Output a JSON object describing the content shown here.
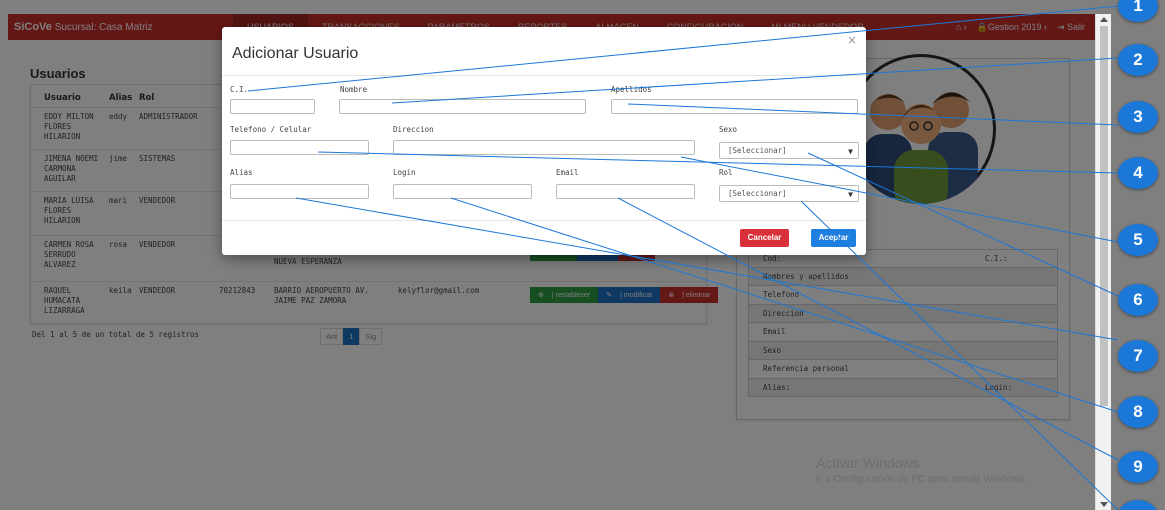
{
  "navbar": {
    "brand_name": "SiCoVe",
    "brand_sub": "Sucursal: Casa Matriz",
    "menu": [
      "USUARIOS",
      "TRANSACCIONES",
      "PARAMETROS",
      "REPORTES",
      "ALMACEN",
      "CONFIGURACION",
      "MI MENU VENDEDOR"
    ],
    "gestion": "Gestion 2019",
    "salir": "Salir"
  },
  "page": {
    "title": "Usuarios",
    "table_headers": {
      "usuario": "Usuario",
      "alias": "Alias",
      "rol": "Rol"
    },
    "rows": [
      {
        "usuario": "EDDY MILTON\nFLORES\nHILARION",
        "alias": "eddy",
        "rol": "ADMINISTRADOR",
        "telefono": "",
        "direccion": "",
        "email": ""
      },
      {
        "usuario": "JIMENA NOEMI\nCARMONA\nAGUILAR",
        "alias": "jime",
        "rol": "SISTEMAS",
        "telefono": "",
        "direccion": "",
        "email": ""
      },
      {
        "usuario": "MARIA LUISA\nFLORES\nHILARION",
        "alias": "mari",
        "rol": "VENDEDOR",
        "telefono": "",
        "direccion": "",
        "email": ""
      },
      {
        "usuario": "CARMEN ROSA\nSERRUDO\nALVAREZ",
        "alias": "rosa",
        "rol": "VENDEDOR",
        "telefono": "",
        "direccion": "NUEVA ESPERANZA",
        "email": ""
      },
      {
        "usuario": "RAQUEL\nHUMACATA\nLIZARRAGA",
        "alias": "keila",
        "rol": "VENDEDOR",
        "telefono": "70212843",
        "direccion": "BARRIO AEROPUERTO AV.\nJAIME PAZ ZAMORA",
        "email": "kelyflor@gmail.com"
      }
    ],
    "actions": {
      "restablecer": "| restablecer",
      "modificar": "| modificar",
      "eliminar": "| eliminar"
    },
    "footer": "Del 1 al 5 de un total de 5 registros",
    "pager": {
      "prev": "Ant",
      "current": "1",
      "next": "Sig"
    }
  },
  "detail": {
    "rows": [
      {
        "left": "Cod:",
        "right": "C.I.:"
      },
      {
        "left": "Nombres y apellidos",
        "right": ""
      },
      {
        "left": "Telefono",
        "right": ""
      },
      {
        "left": "Direccion",
        "right": ""
      },
      {
        "left": "Email",
        "right": ""
      },
      {
        "left": "Sexo",
        "right": ""
      },
      {
        "left": "Referencia personal",
        "right": ""
      },
      {
        "left": "Alias:",
        "right": "Login:"
      }
    ]
  },
  "watermark": {
    "line1": "Activar Windows",
    "line2": "Ir a Configuración de PC para activar Windows."
  },
  "modal": {
    "title": "Adicionar Usuario",
    "close": "×",
    "labels": {
      "ci": "C.I.",
      "nombre": "Nombre",
      "apellidos": "Apellidos",
      "telefono": "Telefono / Celular",
      "direccion": "Direccion",
      "sexo": "Sexo",
      "alias": "Alias",
      "login": "Login",
      "email": "Email",
      "rol": "Rol"
    },
    "values": {
      "ci": "",
      "nombre": "",
      "apellidos": "",
      "telefono": "",
      "direccion": "",
      "alias": "",
      "login": "",
      "email": ""
    },
    "selects": {
      "sexo": "[Seleccionar]",
      "rol": "[Seleccionar]"
    },
    "buttons": {
      "cancel": "Cancelar",
      "accept": "Aceptar"
    }
  },
  "callouts": [
    "1",
    "2",
    "3",
    "4",
    "5",
    "6",
    "7",
    "8",
    "9"
  ],
  "colors": {
    "navbar": "#c9302c",
    "accent_blue": "#1e7fe0",
    "danger": "#d9303a",
    "success": "#2e9e44",
    "callout": "#1c78d8"
  }
}
